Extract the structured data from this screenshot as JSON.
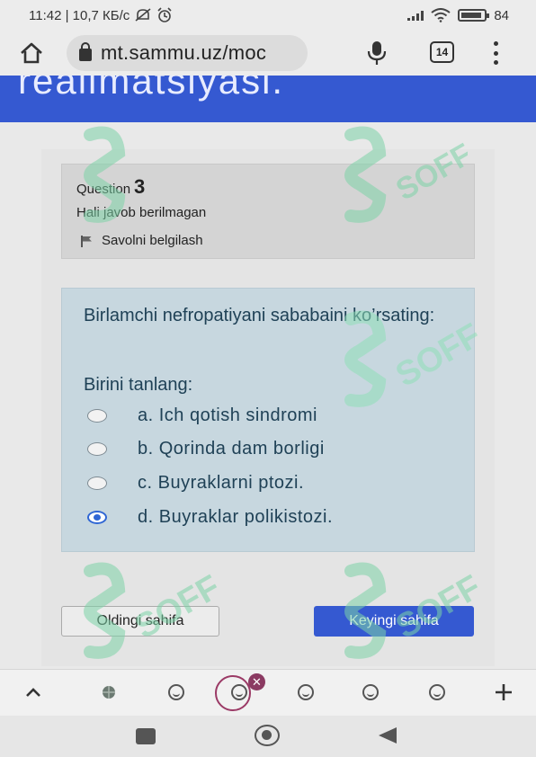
{
  "status_bar": {
    "time_and_speed": "11:42 | 10,7 КБ/с",
    "battery": "84"
  },
  "browser": {
    "url": "mt.sammu.uz/moc",
    "tab_count": "14"
  },
  "header": {
    "title_fragment": "realimatsiyasi."
  },
  "question_info": {
    "label": "Question",
    "number": "3",
    "status": "Hali javob berilmagan",
    "flag_label": "Savolni belgilash"
  },
  "question": {
    "text": "Birlamchi nefropatiyani sababaini ko’rsating:",
    "prompt": "Birini tanlang:",
    "options": [
      {
        "label": "a. Ich qotish sindromi",
        "selected": false
      },
      {
        "label": "b. Qorinda dam borligi",
        "selected": false
      },
      {
        "label": "c. Buyraklarni ptozi.",
        "selected": false
      },
      {
        "label": "d. Buyraklar polikistozi.",
        "selected": true
      }
    ]
  },
  "navigation": {
    "prev_label": "Oldingi sahifa",
    "next_label": "Keyingi sahifa"
  },
  "bottom_bar": {
    "badge": "✕"
  },
  "colors": {
    "accent": "#3559d1",
    "question_bg": "#c7d7df",
    "question_text": "#1f4156",
    "info_bg": "#d4d4d4",
    "watermark": "#7dd3a8"
  },
  "watermark_text": "SOFF"
}
